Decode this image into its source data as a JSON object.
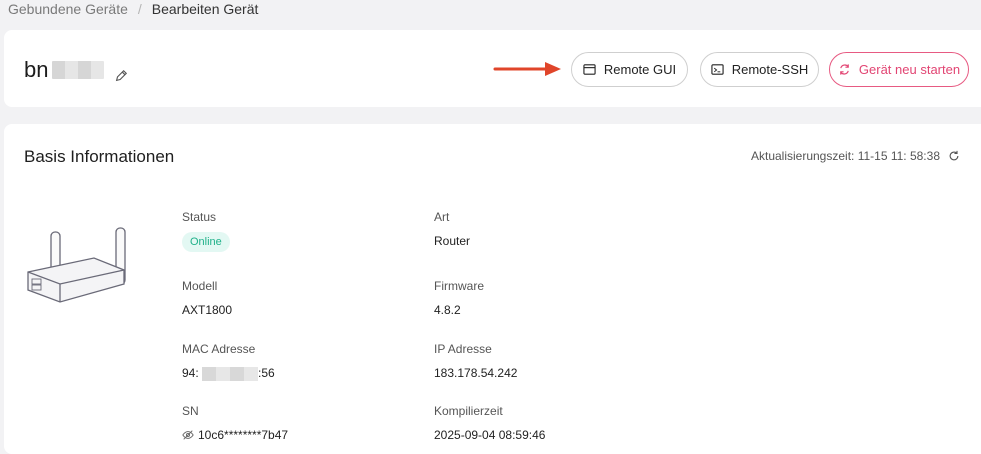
{
  "breadcrumb": {
    "parent": "Gebundene Geräte",
    "separator": "/",
    "current": "Bearbeiten Gerät"
  },
  "device": {
    "name_prefix": "bn"
  },
  "actions": {
    "remote_gui": "Remote GUI",
    "remote_ssh": "Remote-SSH",
    "restart": "Gerät neu starten"
  },
  "info": {
    "title": "Basis Informationen",
    "update_time": "Aktualisierungszeit: 11-15 11: 58:38",
    "status_label": "Status",
    "status_value": "Online",
    "type_label": "Art",
    "type_value": "Router",
    "model_label": "Modell",
    "model_value": "AXT1800",
    "firmware_label": "Firmware",
    "firmware_value": "4.8.2",
    "mac_label": "MAC Adresse",
    "mac_prefix": "94:",
    "mac_suffix": ":56",
    "ip_label": "IP Adresse",
    "ip_value": "183.178.54.242",
    "sn_label": "SN",
    "sn_value": "10c6********7b47",
    "build_label": "Kompilierzeit",
    "build_value": "2025-09-04 08:59:46"
  },
  "colors": {
    "accent_red": "#e24573",
    "online_green": "#20b18a",
    "arrow": "#e0452a"
  },
  "icons": {
    "remote_gui": "window-icon",
    "remote_ssh": "terminal-icon",
    "restart": "restart-icon",
    "refresh": "refresh-icon",
    "edit": "pencil-icon",
    "sn": "eye-slash-icon"
  }
}
